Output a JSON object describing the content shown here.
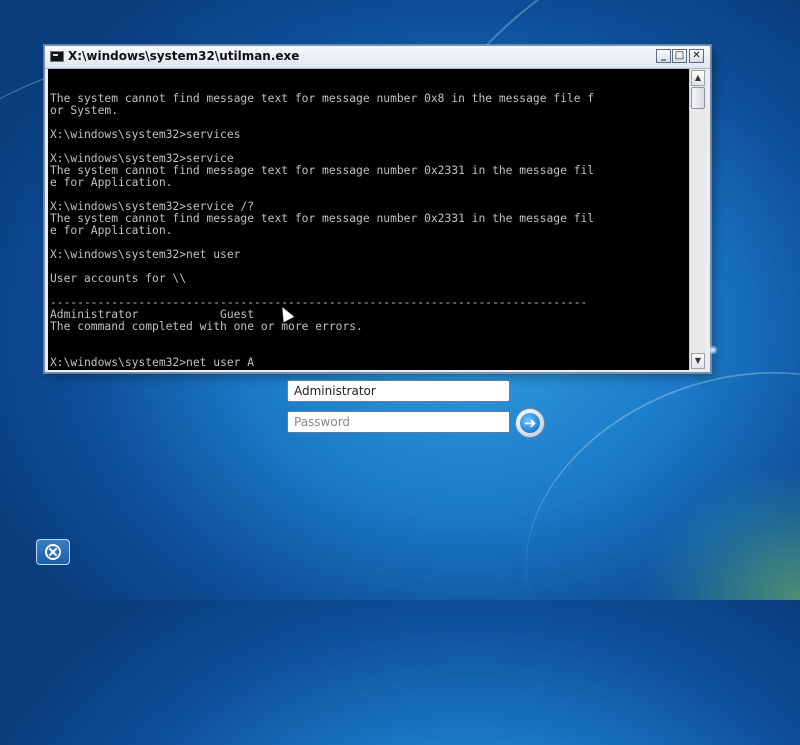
{
  "window": {
    "title": "X:\\windows\\system32\\utilman.exe",
    "buttons": {
      "minimize": "_",
      "maximize": "□",
      "close": "✕"
    }
  },
  "console": {
    "lines": [
      "",
      "",
      "The system cannot find message text for message number 0x8 in the message file f",
      "or System.",
      "",
      "X:\\windows\\system32>services",
      "",
      "X:\\windows\\system32>service",
      "The system cannot find message text for message number 0x2331 in the message fil",
      "e for Application.",
      "",
      "X:\\windows\\system32>service /?",
      "The system cannot find message text for message number 0x2331 in the message fil",
      "e for Application.",
      "",
      "X:\\windows\\system32>net user",
      "",
      "User accounts for \\\\",
      "",
      "-------------------------------------------------------------------------------",
      "Administrator            Guest",
      "The command completed with one or more errors.",
      "",
      "",
      "X:\\windows\\system32>net user A"
    ]
  },
  "scrollbar": {
    "up_arrow": "▲",
    "down_arrow": "▼"
  },
  "login": {
    "username_value": "Administrator",
    "password_placeholder": "Password",
    "submit_glyph": "➔"
  },
  "icons": {
    "cmd": "console-icon",
    "ease_of_access": "ease-of-access-icon",
    "submit": "arrow-right-icon"
  }
}
